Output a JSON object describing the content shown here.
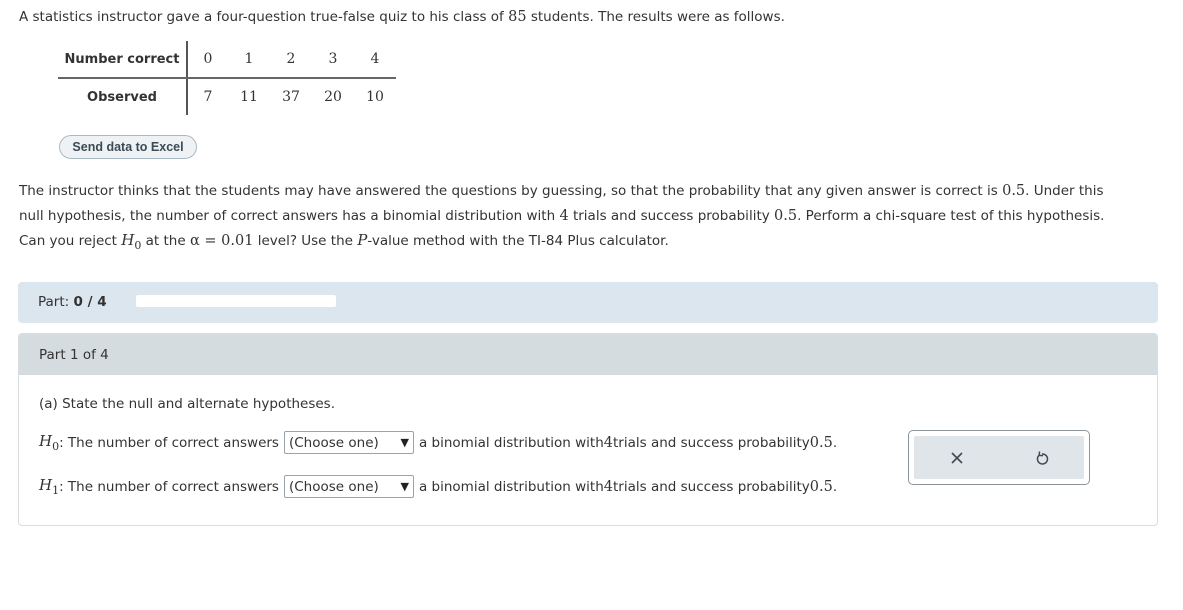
{
  "intro": {
    "before": "A statistics instructor gave a four-question true-false quiz to his class of ",
    "n": "85",
    "after": " students. The results were as follows."
  },
  "table": {
    "row1_header": "Number correct",
    "row2_header": "Observed",
    "number_correct": [
      "0",
      "1",
      "2",
      "3",
      "4"
    ],
    "observed": [
      "7",
      "11",
      "37",
      "20",
      "10"
    ]
  },
  "excel_button": "Send data to Excel",
  "problem": {
    "line1_a": "The instructor thinks that the students may have answered the questions by guessing, so that the probability that any given answer is correct is ",
    "line1_p": "0.5",
    "line1_b": ". Under this",
    "line2_a": "null hypothesis, the number of correct answers has a binomial distribution with ",
    "line2_n": "4",
    "line2_b": " trials and success probability ",
    "line2_p": "0.5",
    "line2_c": ". Perform a chi-square test of this hypothesis.",
    "line3_a": "Can you reject ",
    "line3_h": "H",
    "line3_sub": "0",
    "line3_b": " at the ",
    "line3_alpha": "α = 0.01",
    "line3_c": " level? Use the ",
    "line3_P": "P",
    "line3_d": "-value method with the TI-84 Plus calculator."
  },
  "progress": {
    "label": "Part: ",
    "value": "0 / 4",
    "fraction": 0
  },
  "part": {
    "header": "Part 1 of 4",
    "question": "(a) State the null and alternate hypotheses.",
    "hypotheses": [
      {
        "symbol": "H",
        "sub": "0",
        "text": ": The number of correct answers",
        "select_value": "(Choose one)",
        "after_a": "a binomial distribution with ",
        "after_n": "4",
        "after_b": " trials and success probability ",
        "after_p": "0.5",
        "after_c": "."
      },
      {
        "symbol": "H",
        "sub": "1",
        "text": ": The number of correct answers",
        "select_value": "(Choose one)",
        "after_a": "a binomial distribution with ",
        "after_n": "4",
        "after_b": " trials and success probability ",
        "after_p": "0.5",
        "after_c": "."
      }
    ]
  },
  "actions": {
    "clear_icon": "x-icon",
    "undo_icon": "undo-icon"
  },
  "colors": {
    "progress_bg": "#dce6ef",
    "part_header_bg": "#d5dcdf",
    "action_bg": "#dfe5e8"
  }
}
